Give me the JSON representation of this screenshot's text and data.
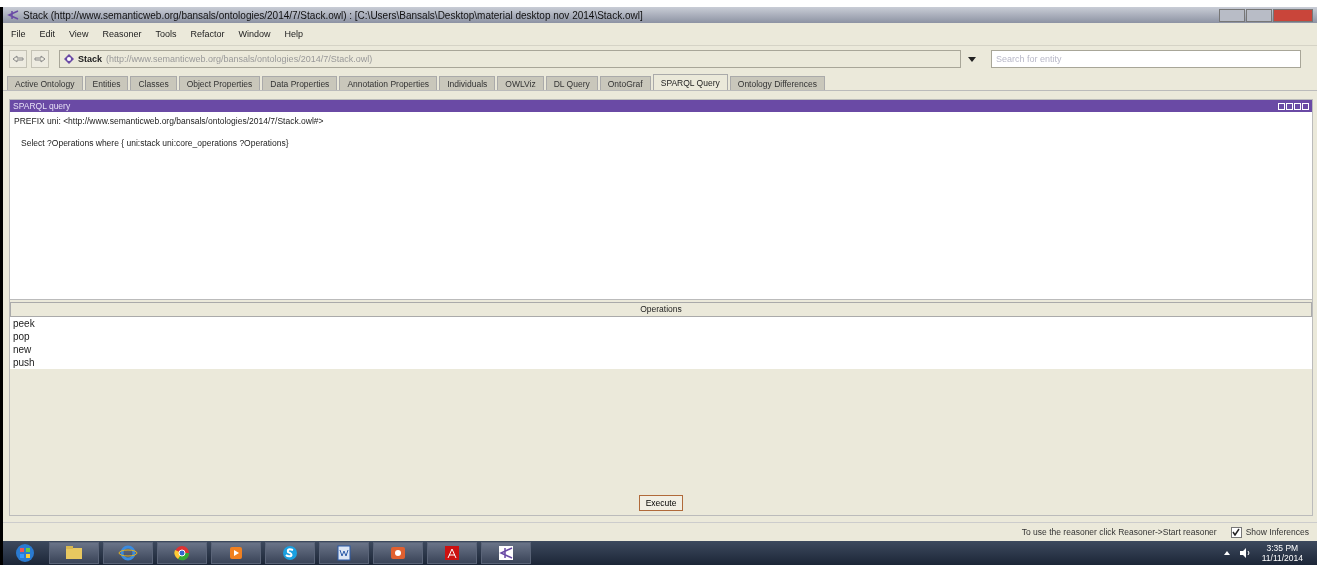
{
  "window": {
    "title": "Stack (http://www.semanticweb.org/bansals/ontologies/2014/7/Stack.owl)  : [C:\\Users\\Bansals\\Desktop\\material desktop nov 2014\\Stack.owl]"
  },
  "menu": [
    "File",
    "Edit",
    "View",
    "Reasoner",
    "Tools",
    "Refactor",
    "Window",
    "Help"
  ],
  "address": {
    "name": "Stack",
    "uri": "(http://www.semanticweb.org/bansals/ontologies/2014/7/Stack.owl)"
  },
  "search": {
    "placeholder": "Search for entity"
  },
  "tabs": [
    {
      "label": "Active Ontology",
      "selected": false
    },
    {
      "label": "Entities",
      "selected": false
    },
    {
      "label": "Classes",
      "selected": false
    },
    {
      "label": "Object Properties",
      "selected": false
    },
    {
      "label": "Data Properties",
      "selected": false
    },
    {
      "label": "Annotation Properties",
      "selected": false
    },
    {
      "label": "Individuals",
      "selected": false
    },
    {
      "label": "OWLViz",
      "selected": false
    },
    {
      "label": "DL Query",
      "selected": false
    },
    {
      "label": "OntoGraf",
      "selected": false
    },
    {
      "label": "SPARQL Query",
      "selected": true
    },
    {
      "label": "Ontology Differences",
      "selected": false
    }
  ],
  "panel": {
    "title": "SPARQL query"
  },
  "query": [
    "PREFIX uni: <http://www.semanticweb.org/bansals/ontologies/2014/7/Stack.owl#>",
    "   Select ?Operations where { uni:stack uni:core_operations ?Operations}"
  ],
  "results": {
    "columns": [
      "Operations"
    ],
    "rows": [
      [
        "peek"
      ],
      [
        "pop"
      ],
      [
        "new"
      ],
      [
        "push"
      ]
    ]
  },
  "execute_button": "Execute",
  "status_bar": {
    "message": "To use the reasoner click Reasoner->Start reasoner",
    "show_inferences": {
      "label": "Show Inferences",
      "checked": true
    }
  },
  "taskbar": {
    "time": "3:35 PM",
    "date": "11/11/2014"
  }
}
